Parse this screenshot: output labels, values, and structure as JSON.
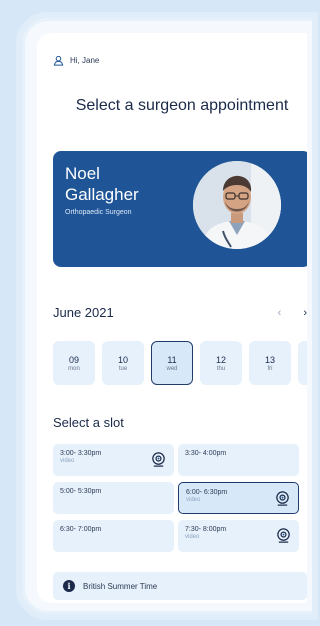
{
  "header": {
    "greeting": "Hi, Jane"
  },
  "page_title": "Select a surgeon appointment",
  "surgeon": {
    "name_first": "Noel",
    "name_last": "Gallagher",
    "role": "Orthopaedic Surgeon"
  },
  "calendar": {
    "month": "June 2021",
    "prev_icon": "‹",
    "next_icon": "›",
    "days": [
      {
        "num": "09",
        "dow": "mon"
      },
      {
        "num": "10",
        "dow": "tue"
      },
      {
        "num": "11",
        "dow": "wed"
      },
      {
        "num": "12",
        "dow": "thu"
      },
      {
        "num": "13",
        "dow": "fri"
      },
      {
        "num": "",
        "dow": ""
      }
    ],
    "selected_day": "11"
  },
  "slots_section": {
    "title": "Select a slot",
    "slots": [
      {
        "time": "3:00- 3:30pm",
        "sub": "video",
        "video": true
      },
      {
        "time": "3:30- 4:00pm",
        "sub": "",
        "video": false
      },
      {
        "time": "5:00- 5:30pm",
        "sub": "",
        "video": false
      },
      {
        "time": "6:00- 6:30pm",
        "sub": "video",
        "video": true
      },
      {
        "time": "6:30- 7:00pm",
        "sub": "",
        "video": false
      },
      {
        "time": "7:30- 8:00pm",
        "sub": "video",
        "video": true
      }
    ],
    "selected_slot": "6:00- 6:30pm"
  },
  "timezone": {
    "label": "British Summer Time",
    "icon": "i"
  },
  "colors": {
    "primary": "#1f5597",
    "tile": "#e6f1fb",
    "dark": "#1b2a4a"
  }
}
